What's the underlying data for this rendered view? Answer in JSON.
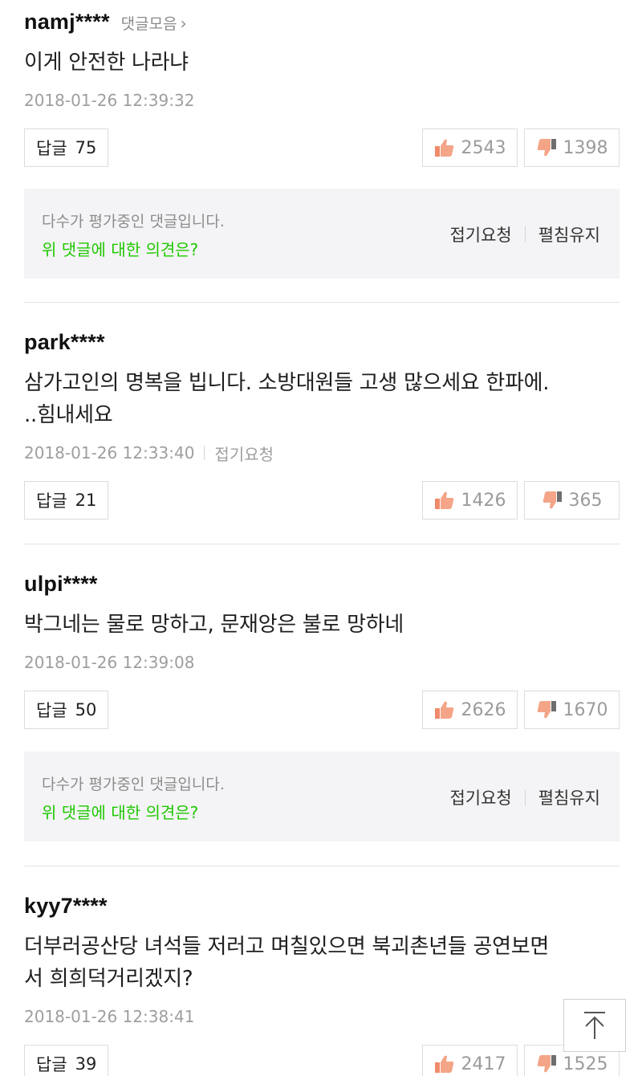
{
  "comments": [
    {
      "author": "namj****",
      "collect_label": "댓글모음",
      "text_lines": [
        "이게 안전한 나라냐"
      ],
      "timestamp": "2018-01-26 12:39:32",
      "reply_label": "답글",
      "reply_count": "75",
      "likes": "2543",
      "dislikes": "1398"
    },
    {
      "author": "park****",
      "text_lines": [
        "삼가고인의 명복을 빕니다. 소방대원들 고생 많으세요 한파에.",
        "..힘내세요"
      ],
      "timestamp": "2018-01-26 12:33:40",
      "fold_label": "접기요청",
      "reply_label": "답글",
      "reply_count": "21",
      "likes": "1426",
      "dislikes": "365"
    },
    {
      "author": "ulpi****",
      "text_lines": [
        "박그네는 물로 망하고, 문재앙은 불로 망하네"
      ],
      "timestamp": "2018-01-26 12:39:08",
      "reply_label": "답글",
      "reply_count": "50",
      "likes": "2626",
      "dislikes": "1670"
    },
    {
      "author": "kyy7****",
      "text_lines": [
        "더부러공산당 녀석들 저러고 며칠있으면 북괴촌년들 공연보면",
        "서 희희덕거리겠지?"
      ],
      "timestamp": "2018-01-26 12:38:41",
      "reply_label": "답글",
      "reply_count": "39",
      "likes": "2417",
      "dislikes": "1525"
    }
  ],
  "evaluation": {
    "notice": "다수가 평가중인 댓글입니다.",
    "question": "위 댓글에 대한 의견은?",
    "fold_request": "접기요청",
    "keep_open": "펼침유지"
  },
  "colors": {
    "accent_green": "#1ec800",
    "like_icon": "#f08a6a",
    "dislike_icon": "#8a8a8a"
  },
  "icons": {
    "like": "thumbs-up-icon",
    "dislike": "thumbs-down-icon",
    "scroll_top": "arrow-up-icon",
    "chevron": "chevron-right-icon"
  }
}
